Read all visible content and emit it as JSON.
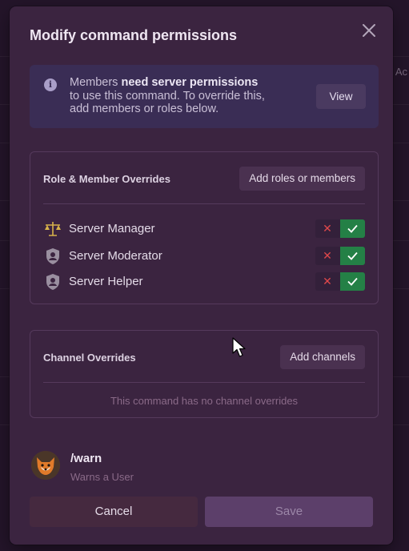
{
  "background": {
    "edge_text": "Ac"
  },
  "modal": {
    "title": "Modify command permissions",
    "info": {
      "text_before": "Members ",
      "text_bold": "need server permissions",
      "text_after": " to use this command. To override this, add members or roles below.",
      "view_label": "View"
    },
    "role_overrides": {
      "heading": "Role & Member Overrides",
      "add_label": "Add roles or members",
      "roles": [
        {
          "name": "Server Manager",
          "icon": "scales-icon"
        },
        {
          "name": "Server Moderator",
          "icon": "shield-icon"
        },
        {
          "name": "Server Helper",
          "icon": "shield-icon"
        }
      ]
    },
    "channel_overrides": {
      "heading": "Channel Overrides",
      "add_label": "Add channels",
      "empty_text": "This command has no channel overrides"
    },
    "command": {
      "name": "/warn",
      "description": "Warns a User"
    },
    "footer": {
      "cancel_label": "Cancel",
      "save_label": "Save"
    }
  },
  "colors": {
    "allow": "#248046",
    "deny": "#e0484b",
    "modal_bg": "#3b2440",
    "info_bg": "#3a2d55"
  }
}
